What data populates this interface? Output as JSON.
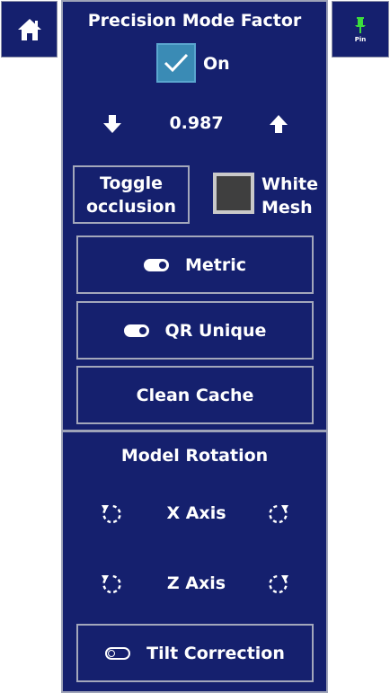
{
  "nav": {
    "home_icon": "home-icon",
    "pin_label": "Pin",
    "pin_icon": "pin-icon",
    "pin_color": "#3cdc3c"
  },
  "precision": {
    "title": "Precision Mode Factor",
    "checkbox_label": "On",
    "checked": true,
    "value": "0.987"
  },
  "controls": {
    "toggle_occlusion_line1": "Toggle",
    "toggle_occlusion_line2": "occlusion",
    "white_mesh_line1": "White",
    "white_mesh_line2": "Mesh",
    "metric_label": "Metric",
    "metric_on": true,
    "qr_label": "QR Unique",
    "qr_on": true,
    "clean_cache_label": "Clean Cache"
  },
  "rotation": {
    "title": "Model Rotation",
    "x_axis_label": "X Axis",
    "z_axis_label": "Z Axis",
    "tilt_label": "Tilt Correction",
    "tilt_on": false
  },
  "colors": {
    "panel": "#15206e",
    "checkbox": "#3a8bb5",
    "border": "#9ea3b8"
  }
}
